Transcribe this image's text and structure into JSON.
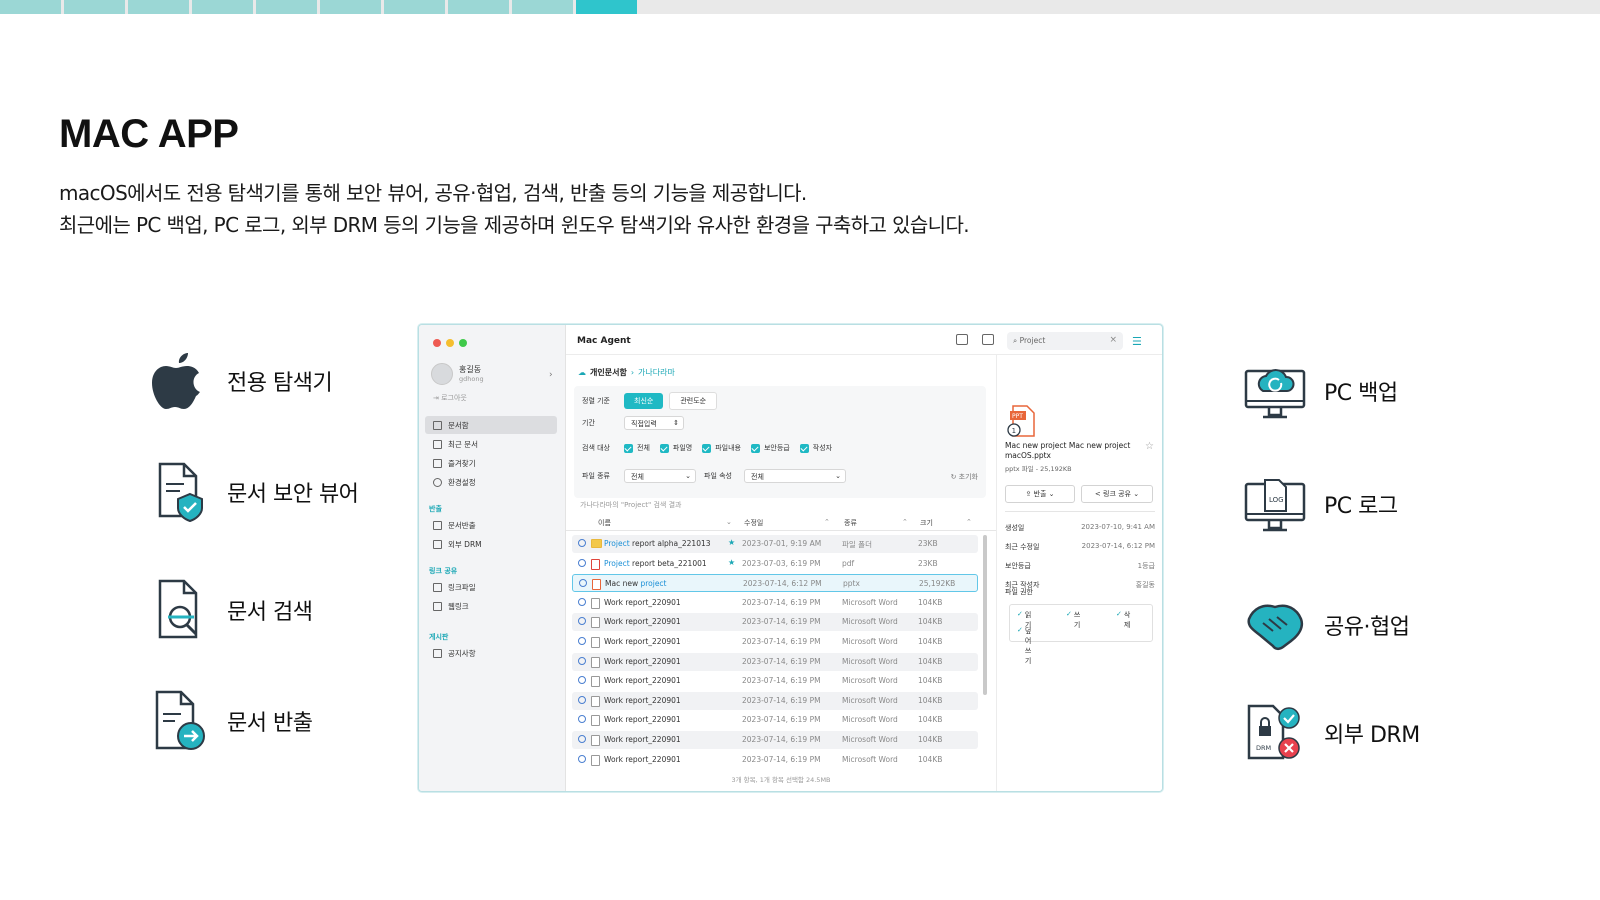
{
  "progress": {
    "segments": 10,
    "active_index": 9
  },
  "slide": {
    "title": "MAC APP",
    "desc1": "macOS에서도 전용 탐색기를 통해 보안 뷰어, 공유·협업, 검색, 반출 등의 기능을 제공합니다.",
    "desc2": "최근에는 PC 백업, PC 로그, 외부 DRM 등의 기능을 제공하며 윈도우 탐색기와 유사한 환경을 구축하고 있습니다."
  },
  "features_left": [
    {
      "label": "전용 탐색기",
      "icon": "apple-icon"
    },
    {
      "label": "문서 보안 뷰어",
      "icon": "document-shield-icon"
    },
    {
      "label": "문서 검색",
      "icon": "document-search-icon"
    },
    {
      "label": "문서 반출",
      "icon": "document-export-icon"
    }
  ],
  "features_right": [
    {
      "label": "PC 백업",
      "icon": "monitor-cloud-backup-icon"
    },
    {
      "label": "PC 로그",
      "icon": "monitor-log-icon"
    },
    {
      "label": "공유·협업",
      "icon": "handshake-icon"
    },
    {
      "label": "외부 DRM",
      "icon": "drm-document-icon"
    }
  ],
  "colors": {
    "accent": "#1fb9c4",
    "progress_active": "#2fc5cc",
    "progress_done": "#9bd7d5",
    "icon_dark": "#2d3a45",
    "icon_teal": "#25b3c0"
  },
  "app": {
    "title": "Mac Agent",
    "search_text": "Project",
    "user": {
      "name": "홍길동",
      "id": "gdhong"
    },
    "logout": "로그아웃",
    "sidebar": {
      "items_main": [
        "문서함",
        "최근 문서",
        "즐겨찾기",
        "환경설정"
      ],
      "section_export": "반출",
      "items_export": [
        "문서반출",
        "외부 DRM"
      ],
      "section_link": "링크 공유",
      "items_link": [
        "링크파일",
        "웹링크"
      ],
      "section_board": "게시판",
      "items_board": [
        "공지사항"
      ]
    },
    "breadcrumb": {
      "root": "개인문서함",
      "current": "가나다라마"
    },
    "filters": {
      "sort_label": "정렬 기준",
      "sort_on": "최신순",
      "sort_off": "관련도순",
      "period_label": "기간",
      "period_value": "직접입력",
      "target_label": "검색 대상",
      "targets": [
        "전체",
        "파일명",
        "파일내용",
        "보안등급",
        "작성자"
      ],
      "type_label": "파일 종류",
      "type_value": "전체",
      "attr_label": "파일 속성",
      "attr_value": "전체",
      "reset": "초기화"
    },
    "result_note": "가나다라마의 \"Project\" 검색 결과",
    "columns": [
      "이름",
      "수정일",
      "종류",
      "크기"
    ],
    "rows": [
      {
        "pre": "",
        "hit": "Project",
        "post": " report alpha_221013",
        "date": "2023-07-01, 9:19 AM",
        "type": "파일 폴더",
        "size": "23KB",
        "star": true,
        "kind": "folder"
      },
      {
        "pre": "",
        "hit": "Project",
        "post": " report beta_221001",
        "date": "2023-07-03, 6:19 PM",
        "type": "pdf",
        "size": "23KB",
        "star": true,
        "kind": "pdf"
      },
      {
        "pre": "Mac new ",
        "hit": "project",
        "post": "",
        "date": "2023-07-14, 6:12 PM",
        "type": "pptx",
        "size": "25,192KB",
        "star": false,
        "kind": "ppt"
      },
      {
        "pre": "Work report_220901",
        "hit": "",
        "post": "",
        "date": "2023-07-14, 6:19 PM",
        "type": "Microsoft Word",
        "size": "104KB",
        "star": false,
        "kind": "doc"
      },
      {
        "pre": "Work report_220901",
        "hit": "",
        "post": "",
        "date": "2023-07-14, 6:19 PM",
        "type": "Microsoft Word",
        "size": "104KB",
        "star": false,
        "kind": "doc"
      },
      {
        "pre": "Work report_220901",
        "hit": "",
        "post": "",
        "date": "2023-07-14, 6:19 PM",
        "type": "Microsoft Word",
        "size": "104KB",
        "star": false,
        "kind": "doc"
      },
      {
        "pre": "Work report_220901",
        "hit": "",
        "post": "",
        "date": "2023-07-14, 6:19 PM",
        "type": "Microsoft Word",
        "size": "104KB",
        "star": false,
        "kind": "doc"
      },
      {
        "pre": "Work report_220901",
        "hit": "",
        "post": "",
        "date": "2023-07-14, 6:19 PM",
        "type": "Microsoft Word",
        "size": "104KB",
        "star": false,
        "kind": "doc"
      },
      {
        "pre": "Work report_220901",
        "hit": "",
        "post": "",
        "date": "2023-07-14, 6:19 PM",
        "type": "Microsoft Word",
        "size": "104KB",
        "star": false,
        "kind": "doc"
      },
      {
        "pre": "Work report_220901",
        "hit": "",
        "post": "",
        "date": "2023-07-14, 6:19 PM",
        "type": "Microsoft Word",
        "size": "104KB",
        "star": false,
        "kind": "doc"
      },
      {
        "pre": "Work report_220901",
        "hit": "",
        "post": "",
        "date": "2023-07-14, 6:19 PM",
        "type": "Microsoft Word",
        "size": "104KB",
        "star": false,
        "kind": "doc"
      },
      {
        "pre": "Work report_220901",
        "hit": "",
        "post": "",
        "date": "2023-07-14, 6:19 PM",
        "type": "Microsoft Word",
        "size": "104KB",
        "star": false,
        "kind": "doc"
      }
    ],
    "status": "3개 항목, 1개 항목 선택함 24.5MB",
    "detail": {
      "badge": "1",
      "filename": "Mac new project Mac new project macOS.pptx",
      "meta": "pptx 파일 - 25,192KB",
      "btn_export": "반출",
      "btn_link": "링크 공유",
      "props": [
        {
          "k": "생성일",
          "v": "2023-07-10, 9:41 AM"
        },
        {
          "k": "최근 수정일",
          "v": "2023-07-14, 6:12 PM"
        },
        {
          "k": "보안등급",
          "v": "1등급"
        },
        {
          "k": "최근 작성자",
          "v": "홍길동"
        }
      ],
      "perm_label": "파일 권한",
      "perms": [
        "읽기",
        "쓰기",
        "삭제",
        "덮어쓰기"
      ]
    }
  }
}
